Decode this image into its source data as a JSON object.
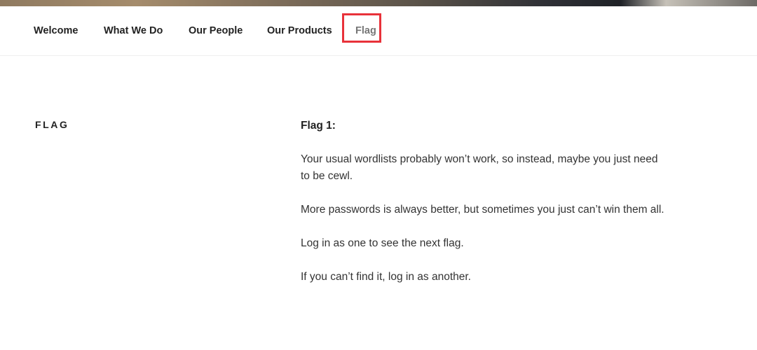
{
  "nav": {
    "items": [
      {
        "label": "Welcome"
      },
      {
        "label": "What We Do"
      },
      {
        "label": "Our People"
      },
      {
        "label": "Our Products"
      },
      {
        "label": "Flag"
      }
    ],
    "active_item": "Flag",
    "highlight_color": "#e8323a"
  },
  "main": {
    "section_title": "FLAG",
    "heading": "Flag 1:",
    "paragraphs": [
      "Your usual wordlists probably won’t work, so instead, maybe you just need to be cewl.",
      "More passwords is always better, but sometimes you just can’t win them all.",
      "Log in as one to see the next flag.",
      "If you can’t find it, log in as another."
    ]
  }
}
